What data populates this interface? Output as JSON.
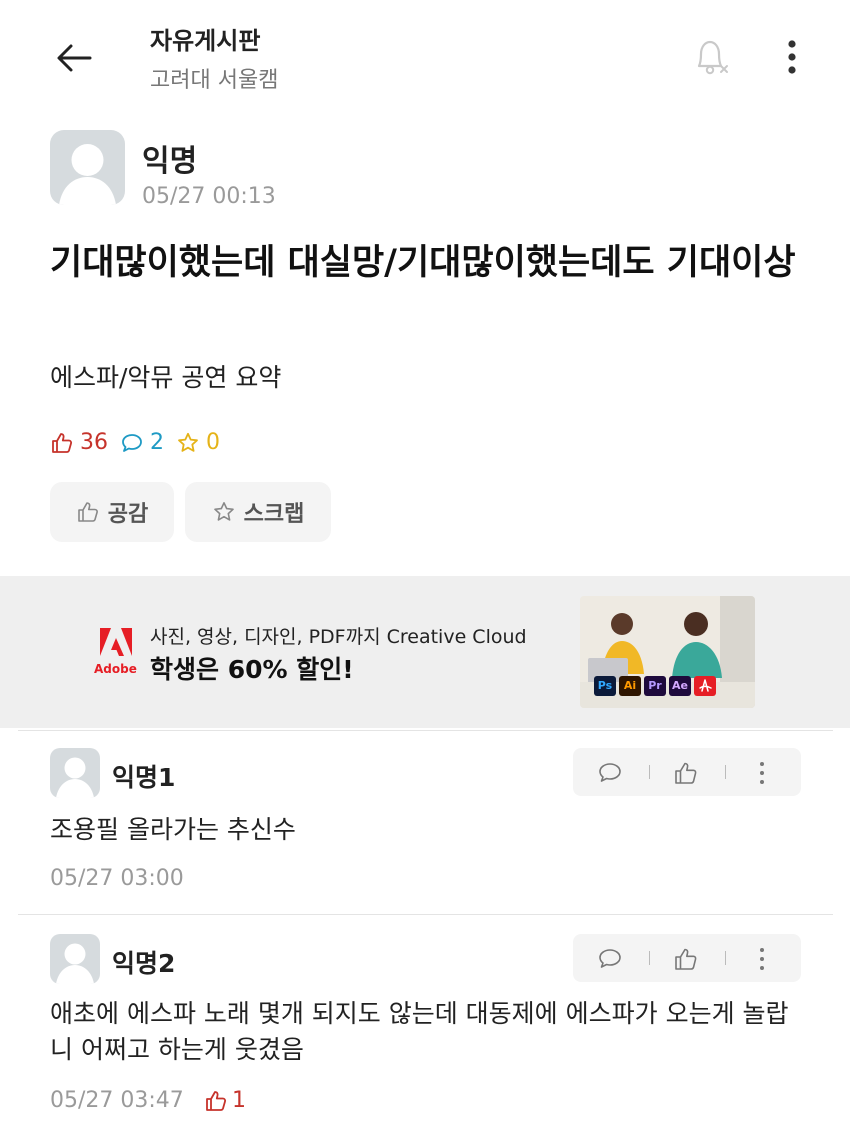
{
  "header": {
    "board_title": "자유게시판",
    "school": "고려대 서울캠"
  },
  "post": {
    "author": "익명",
    "time": "05/27 00:13",
    "title": "기대많이했는데 대실망/기대많이했는데도 기대이상",
    "body": "에스파/악뮤 공연 요약",
    "likes": "36",
    "comments": "2",
    "scraps": "0",
    "like_button": "공감",
    "scrap_button": "스크랩"
  },
  "ad": {
    "brand": "Adobe",
    "line1": "사진, 영상, 디자인, PDF까지 Creative Cloud",
    "line2": "학생은 60% 할인!",
    "app_icons": [
      "Ps",
      "Ai",
      "Pr",
      "Ae"
    ]
  },
  "comments": [
    {
      "author": "익명1",
      "text": "조용필 올라가는 추신수",
      "time": "05/27 03:00"
    },
    {
      "author": "익명2",
      "text": "애초에 에스파 노래 몇개 되지도 않는데 대동제에 에스파가 오는게 놀랍니 어쩌고 하는게 웃겼음",
      "time": "05/27 03:47",
      "likes": "1"
    }
  ],
  "colors": {
    "like": "#c6332b",
    "comment": "#1e9ac4",
    "scrap": "#e5b318",
    "adobe_red": "#e61e25"
  }
}
